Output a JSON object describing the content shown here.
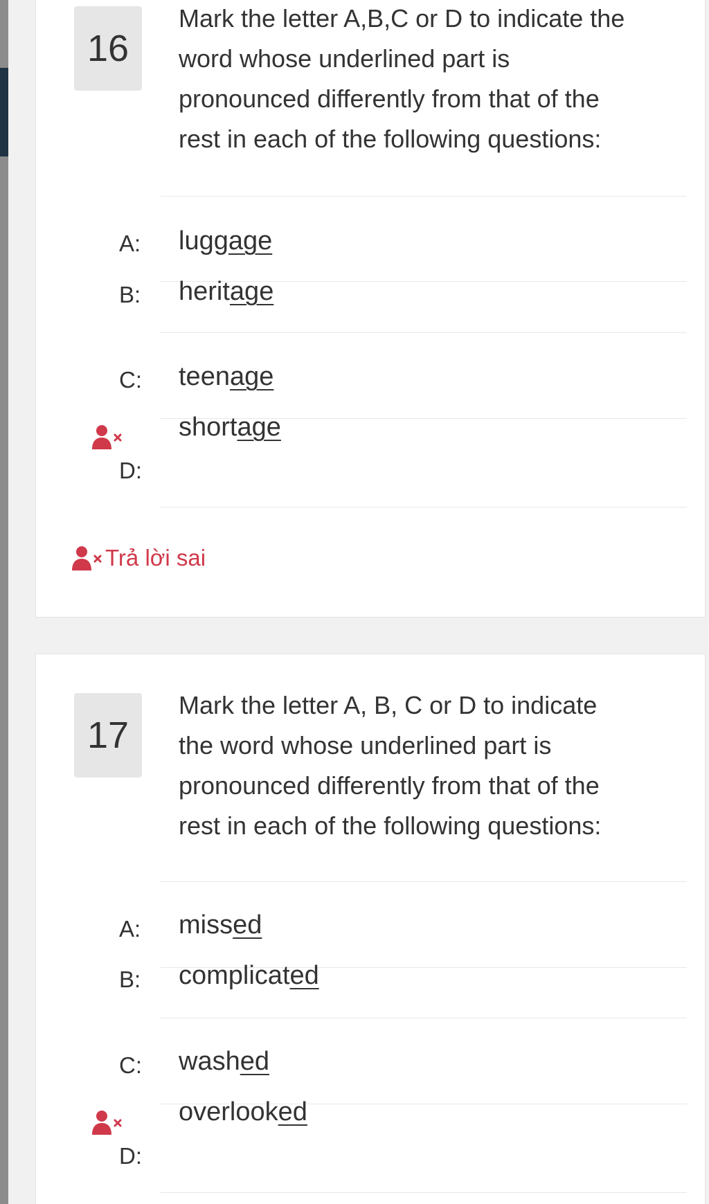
{
  "colors": {
    "wrong_accent": "#d0394a",
    "text": "#333333",
    "number_box": "#e6e6e6"
  },
  "questions": [
    {
      "number": "16",
      "prompt": "Mark the letter A,B,C or D to indicate the word whose underlined part is pronounced differently from that of the rest in each of the following questions:",
      "prompt_lines": [
        "Mark the letter A,B,C or D to indicate the",
        "word whose underlined part is",
        "pronounced differently from that of the",
        "rest in each of the following questions:"
      ],
      "options": [
        {
          "letter": "A:",
          "prefix": "lugg",
          "underlined": "age"
        },
        {
          "letter": "B:",
          "prefix": "herit",
          "underlined": "age"
        },
        {
          "letter": "C:",
          "prefix": "teen",
          "underlined": "age"
        },
        {
          "letter": "D:",
          "prefix": "short",
          "underlined": "age",
          "selected_wrong_icon": "user-times-icon"
        }
      ],
      "feedback": {
        "icon": "user-times-icon",
        "text": "Trả lời sai"
      }
    },
    {
      "number": "17",
      "prompt": "Mark the letter A, B, C or D to indicate the word whose underlined part is pronounced differently from that of the rest in each of the following questions:",
      "prompt_lines": [
        "Mark the letter A, B, C or D to indicate",
        "the word whose underlined part is",
        "pronounced differently from that of the",
        "rest in each of the following questions:"
      ],
      "options": [
        {
          "letter": "A:",
          "prefix": "miss",
          "underlined": "ed"
        },
        {
          "letter": "B:",
          "prefix": "complicat",
          "underlined": "ed"
        },
        {
          "letter": "C:",
          "prefix": "wash",
          "underlined": "ed"
        },
        {
          "letter": "D:",
          "prefix": "overlook",
          "underlined": "ed",
          "selected_wrong_icon": "user-times-icon"
        }
      ]
    }
  ]
}
